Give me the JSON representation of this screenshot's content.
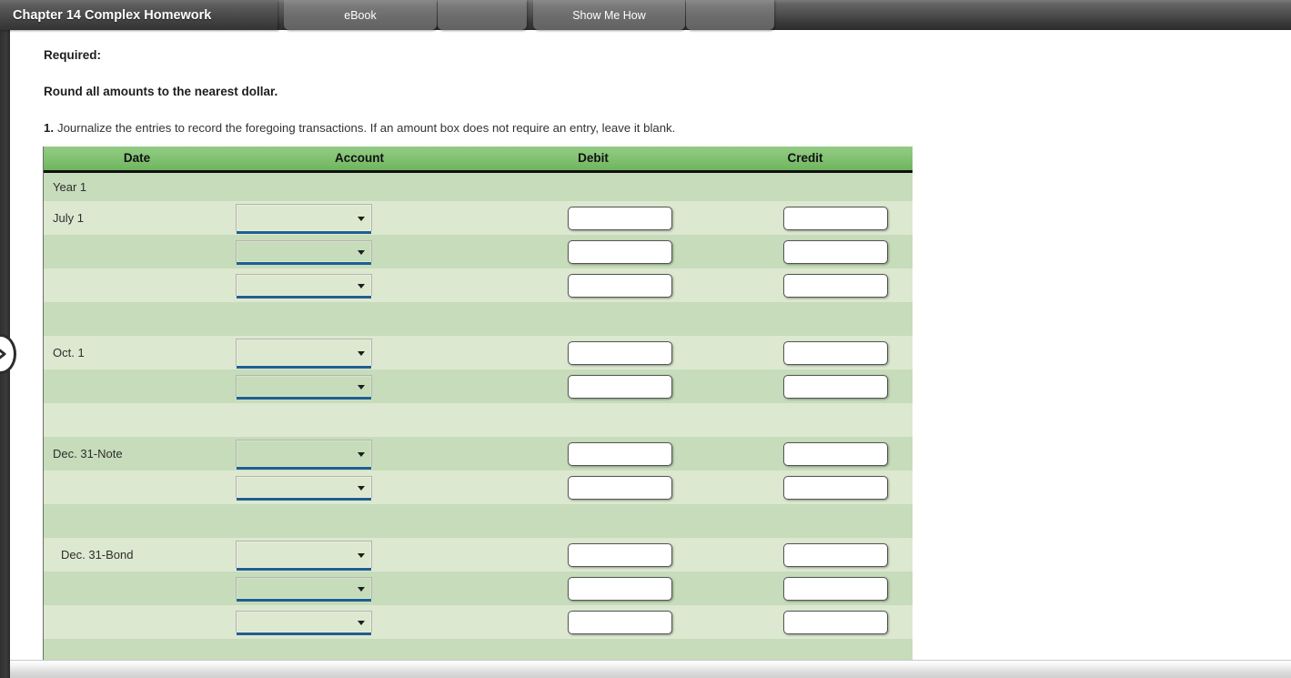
{
  "topbar": {
    "title": "Chapter 14 Complex Homework",
    "tabs": [
      {
        "label": "eBook",
        "name": "tab-ebook"
      },
      {
        "label": "",
        "name": "tab-blank-1"
      },
      {
        "label": "Show Me How",
        "name": "tab-show-me-how"
      },
      {
        "label": "",
        "name": "tab-blank-2"
      }
    ]
  },
  "expander": {
    "icon": "chevron-right-icon"
  },
  "instructions": {
    "required_label": "Required:",
    "rounding_note": "Round all amounts to the nearest dollar.",
    "question_number": "1.",
    "question_text": "Journalize the entries to record the foregoing transactions. If an amount box does not require an entry, leave it blank."
  },
  "journal": {
    "columns": [
      "Date",
      "Account",
      "Debit",
      "Credit"
    ],
    "year_label": "Year 1",
    "rows": [
      {
        "type": "year",
        "date": "Year 1",
        "shade": "a"
      },
      {
        "type": "entry",
        "date": "July 1",
        "shade": "b",
        "select_variant": "large",
        "debit": "",
        "credit": ""
      },
      {
        "type": "entry",
        "date": "",
        "shade": "a",
        "select_variant": "small",
        "debit": "",
        "credit": ""
      },
      {
        "type": "entry",
        "date": "",
        "shade": "b",
        "select_variant": "small",
        "debit": "",
        "credit": ""
      },
      {
        "type": "gap",
        "date": "",
        "shade": "a"
      },
      {
        "type": "entry",
        "date": "Oct. 1",
        "shade": "b",
        "select_variant": "large",
        "debit": "",
        "credit": ""
      },
      {
        "type": "entry",
        "date": "",
        "shade": "a",
        "select_variant": "small",
        "debit": "",
        "credit": ""
      },
      {
        "type": "gap",
        "date": "",
        "shade": "b"
      },
      {
        "type": "entry",
        "date": "Dec. 31-Note",
        "shade": "a",
        "select_variant": "large",
        "debit": "",
        "credit": ""
      },
      {
        "type": "entry",
        "date": "",
        "shade": "b",
        "select_variant": "small",
        "debit": "",
        "credit": ""
      },
      {
        "type": "gap",
        "date": "",
        "shade": "a"
      },
      {
        "type": "entry",
        "date": "Dec. 31-Bond",
        "shade": "b",
        "select_variant": "large",
        "indent": true,
        "debit": "",
        "credit": ""
      },
      {
        "type": "entry",
        "date": "",
        "shade": "a",
        "select_variant": "small",
        "debit": "",
        "credit": ""
      },
      {
        "type": "entry",
        "date": "",
        "shade": "b",
        "select_variant": "small",
        "debit": "",
        "credit": ""
      },
      {
        "type": "gap",
        "date": "",
        "shade": "a"
      }
    ]
  },
  "colors": {
    "header_green_light": "#93cc84",
    "header_green_dark": "#6fb55e",
    "row_shade_dark": "#c6dcba",
    "row_shade_light": "#dde8d0",
    "select_underline": "#1f5f92",
    "topbar_dark": "#3a3a3a"
  }
}
